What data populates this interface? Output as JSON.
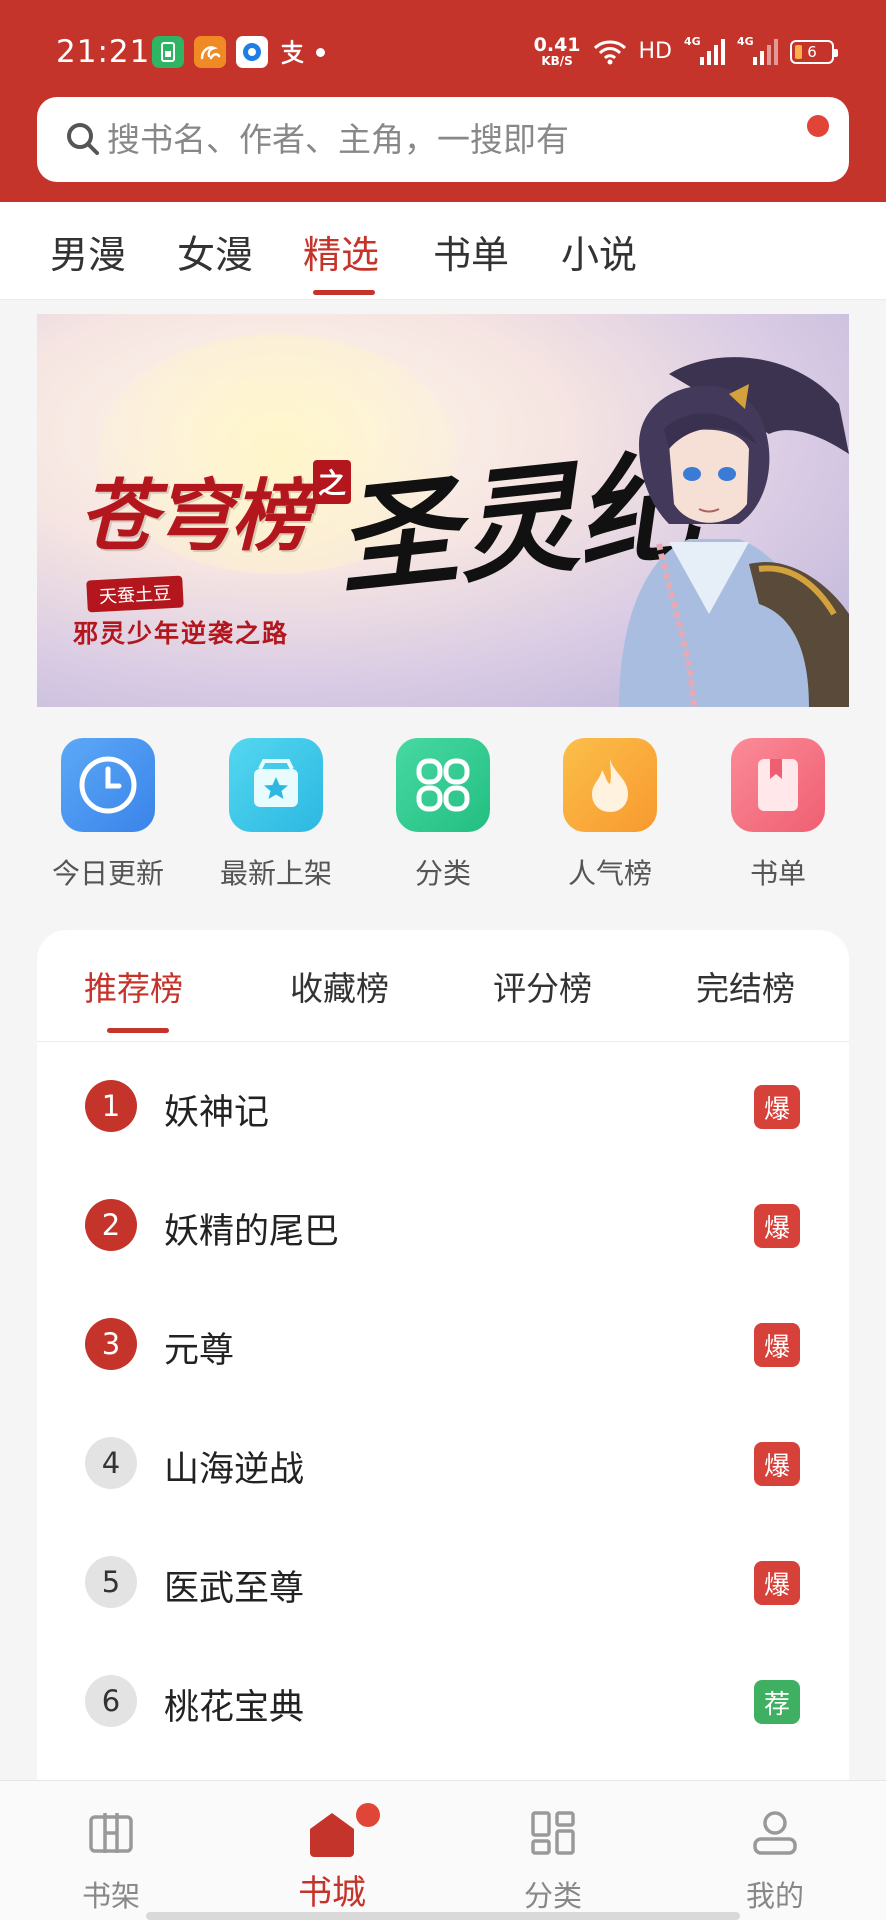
{
  "status_bar": {
    "time": "21:21",
    "net_speed_value": "0.41",
    "net_speed_unit": "KB/S",
    "hd_label": "HD",
    "signal_1_label": "4G",
    "signal_2_label": "4G",
    "battery": "6"
  },
  "search": {
    "placeholder": "搜书名、作者、主角，一搜即有"
  },
  "top_tabs": [
    "男漫",
    "女漫",
    "精选",
    "书单",
    "小说"
  ],
  "active_top_tab": "精选",
  "banner": {
    "title": "苍穹榜",
    "title_connector": "之",
    "title_second": "圣灵纪",
    "author": "天蚕土豆",
    "subtitle": "邪灵少年逆袭之路"
  },
  "quick_entries": [
    {
      "label": "今日更新",
      "icon": "clock-icon"
    },
    {
      "label": "最新上架",
      "icon": "star-box-icon"
    },
    {
      "label": "分类",
      "icon": "grid-icon"
    },
    {
      "label": "人气榜",
      "icon": "flame-icon"
    },
    {
      "label": "书单",
      "icon": "bookmark-book-icon"
    }
  ],
  "rank_tabs": [
    "推荐榜",
    "收藏榜",
    "评分榜",
    "完结榜"
  ],
  "active_rank_tab": "推荐榜",
  "rank_list": [
    {
      "rank": "1",
      "title": "妖神记",
      "badge": "爆"
    },
    {
      "rank": "2",
      "title": "妖精的尾巴",
      "badge": "爆"
    },
    {
      "rank": "3",
      "title": "元尊",
      "badge": "爆"
    },
    {
      "rank": "4",
      "title": "山海逆战",
      "badge": "爆"
    },
    {
      "rank": "5",
      "title": "医武至尊",
      "badge": "爆"
    },
    {
      "rank": "6",
      "title": "桃花宝典",
      "badge": "荐"
    }
  ],
  "bottom_nav": [
    {
      "label": "书架",
      "icon": "bookshelf-icon"
    },
    {
      "label": "书城",
      "icon": "home-icon"
    },
    {
      "label": "分类",
      "icon": "category-grid-icon"
    },
    {
      "label": "我的",
      "icon": "profile-icon"
    }
  ],
  "active_bottom_nav": "书城",
  "colors": {
    "brand_red": "#c5342b",
    "hot_badge": "#d6413a",
    "recommend_badge": "#3fb062",
    "background": "#f5f5f5"
  }
}
